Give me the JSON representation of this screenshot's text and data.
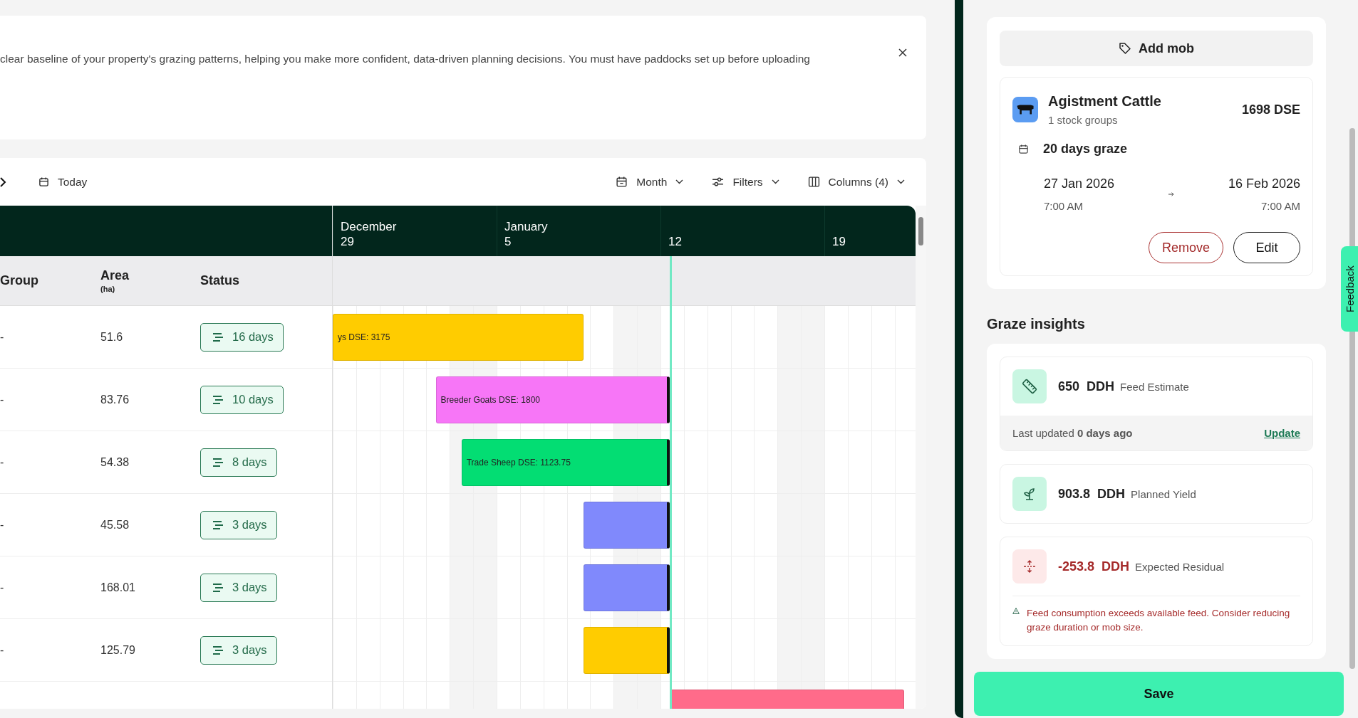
{
  "banner": {
    "text": "clear baseline of your property's grazing patterns, helping you make more confident, data-driven planning decisions. You must have paddocks set up before uploading"
  },
  "toolbar": {
    "today": "Today",
    "controls": [
      {
        "kind": "month",
        "label": "Month"
      },
      {
        "kind": "filters",
        "label": "Filters"
      },
      {
        "kind": "columns",
        "label": "Columns (4)"
      }
    ]
  },
  "columns": [
    {
      "label": "Group"
    },
    {
      "label": "Area",
      "unit": "(ha)"
    },
    {
      "label": "Status"
    }
  ],
  "rows": [
    {
      "group": "-",
      "area": "51.6",
      "status": "16 days",
      "bar": {
        "label": "ys DSE: 3175",
        "color": "#ffcc00",
        "ongoing": false
      }
    },
    {
      "group": "-",
      "area": "83.76",
      "status": "10 days",
      "bar": {
        "label": "Breeder Goats DSE: 1800",
        "color": "#f776f7",
        "ongoing": true
      }
    },
    {
      "group": "-",
      "area": "54.38",
      "status": "8 days",
      "bar": {
        "label": "Trade Sheep DSE: 1123.75",
        "color": "#03dd73",
        "ongoing": true
      }
    },
    {
      "group": "-",
      "area": "45.58",
      "status": "3 days",
      "bar": {
        "color": "#8089fc",
        "ongoing": true
      }
    },
    {
      "group": "-",
      "area": "168.01",
      "status": "3 days",
      "bar": {
        "color": "#8089fc",
        "ongoing": true
      }
    },
    {
      "group": "-",
      "area": "125.79",
      "status": "3 days",
      "bar": {
        "color": "#ffcc00",
        "ongoing": true
      }
    },
    {
      "bar": {
        "color": "#ff6b8a",
        "ongoing": false
      }
    }
  ],
  "timeline": {
    "weeks": [
      {
        "month": "December",
        "day": "29"
      },
      {
        "month": "January",
        "day": "5"
      },
      {
        "day": "12"
      },
      {
        "day": "19"
      }
    ]
  },
  "mob_panel": {
    "add_button": "Add mob",
    "mob": {
      "name": "Agistment Cattle",
      "subtitle": "1 stock groups",
      "dse": "1698 DSE",
      "graze": "20 days graze",
      "from": {
        "date": "27 Jan 2026",
        "time": "7:00 AM"
      },
      "to": {
        "date": "16 Feb 2026",
        "time": "7:00 AM"
      },
      "actions": [
        {
          "kind": "remove",
          "label": "Remove"
        },
        {
          "kind": "edit",
          "label": "Edit"
        }
      ]
    }
  },
  "insights": {
    "title": "Graze insights",
    "items": [
      {
        "kind": "feed",
        "value": "650",
        "unit": "DDH",
        "label": "Feed Estimate",
        "footer": {
          "text": "Last updated **0 days ago**",
          "link": "Update"
        }
      },
      {
        "kind": "yield",
        "value": "903.8",
        "unit": "DDH",
        "label": "Planned Yield"
      },
      {
        "kind": "residual",
        "value": "-253.8",
        "unit": "DDH",
        "label": "Expected Residual",
        "warning": "Feed consumption exceeds available feed. Consider reducing graze duration or mob size."
      }
    ]
  },
  "save": "Save",
  "feedback": "Feedback"
}
